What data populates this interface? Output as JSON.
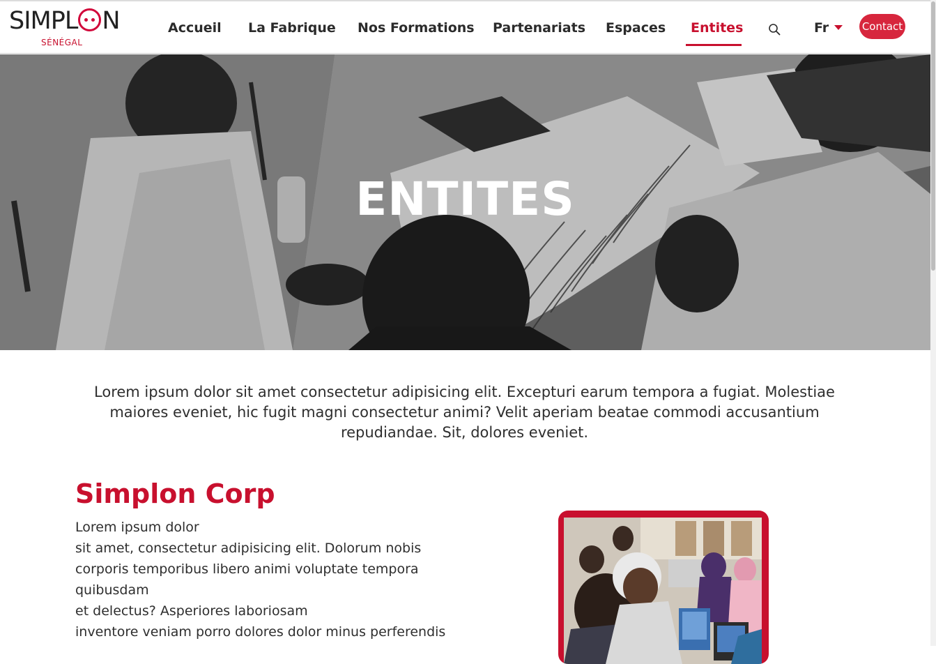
{
  "header": {
    "logo_text": "SIMPLON",
    "logo_sub": "SÉNÉGAL",
    "nav": [
      {
        "label": "Accueil"
      },
      {
        "label": "La Fabrique"
      },
      {
        "label": "Nos Formations"
      },
      {
        "label": "Partenariats"
      },
      {
        "label": "Espaces"
      },
      {
        "label": "Entites",
        "active": true
      }
    ],
    "search_icon": "search-icon",
    "language": "Fr",
    "contact_label": "Contact",
    "accent_color": "#c8102e"
  },
  "hero": {
    "title": "ENTITES"
  },
  "intro": {
    "text": "Lorem ipsum dolor sit amet consectetur adipisicing elit. Excepturi earum tempora a fugiat. Molestiae maiores eveniet, hic fugit magni consectetur animi? Velit aperiam beatae commodi accusantium repudiandae. Sit, dolores eveniet."
  },
  "section": {
    "title": "Simplon Corp",
    "lines": [
      "Lorem ipsum dolor",
      "sit amet, consectetur adipisicing elit. Dolorum nobis",
      "corporis temporibus libero animi voluptate tempora",
      "quibusdam",
      "et delectus? Asperiores laboriosam",
      "inventore veniam porro dolores dolor minus perferendis"
    ]
  }
}
